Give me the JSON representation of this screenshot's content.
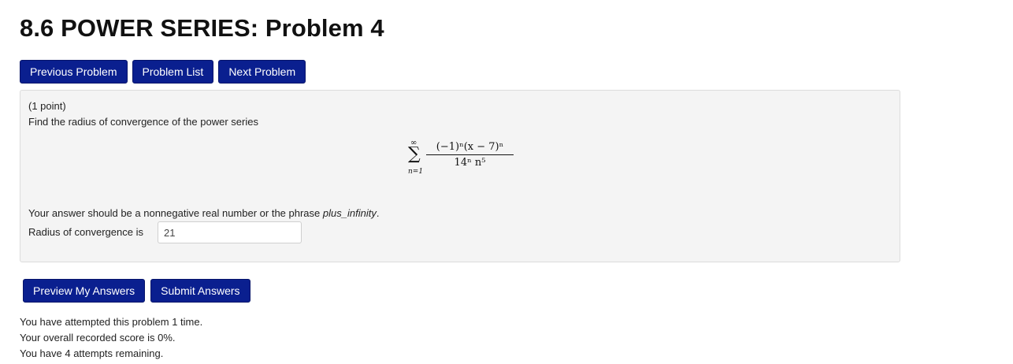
{
  "page": {
    "title": "8.6 POWER SERIES: Problem 4"
  },
  "nav": {
    "previous": "Previous Problem",
    "list": "Problem List",
    "next": "Next Problem"
  },
  "problem": {
    "points": "(1 point)",
    "statement": "Find the radius of convergence of the power series",
    "formula": {
      "sum_upper": "∞",
      "sum_symbol": "∑",
      "sum_lower": "n=1",
      "numerator": "(−1)ⁿ(x − 7)ⁿ",
      "denominator": "14ⁿ n⁵"
    },
    "instruction_prefix": "Your answer should be a nonnegative real number or the phrase ",
    "instruction_phrase": "plus_infinity",
    "instruction_suffix": ".",
    "answer_label": "Radius of convergence is",
    "answer_value": "21"
  },
  "actions": {
    "preview": "Preview My Answers",
    "submit": "Submit Answers"
  },
  "status": {
    "attempts": "You have attempted this problem 1 time.",
    "score": "Your overall recorded score is 0%.",
    "remaining": "You have 4 attempts remaining."
  }
}
